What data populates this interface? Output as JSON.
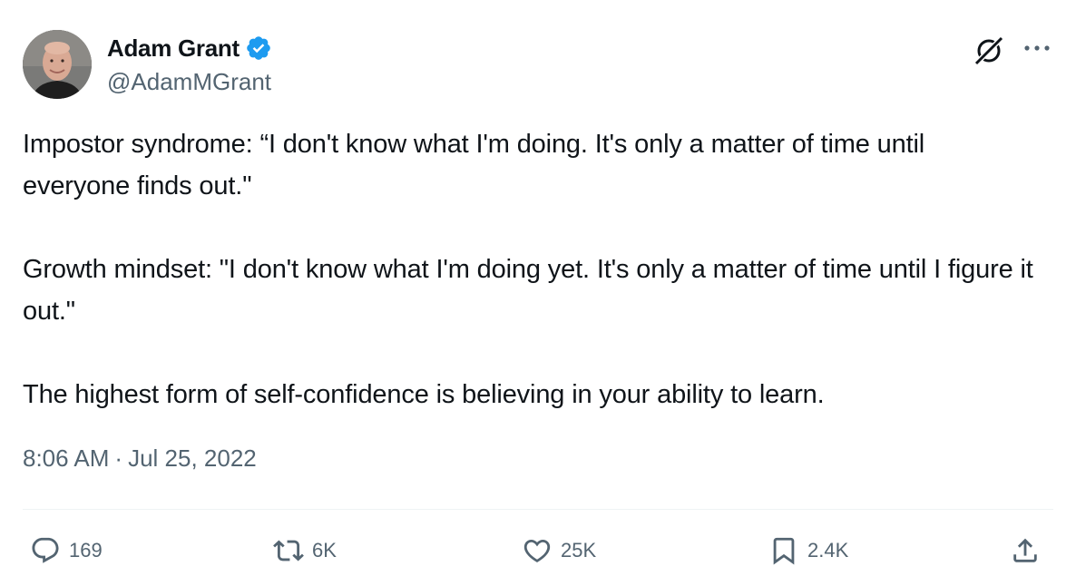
{
  "author": {
    "display_name": "Adam Grant",
    "handle": "@AdamMGrant",
    "verified": true,
    "verified_color": "#1d9bf0"
  },
  "tweet": {
    "paragraphs": [
      "Impostor syndrome: “I don't know what I'm doing. It's only a matter of time until everyone finds out.\"",
      "Growth mindset: \"I don't know what I'm doing yet. It's only a matter of time until I figure it out.\"",
      "The highest form of self-confidence is believing in your ability to learn."
    ],
    "time": "8:06 AM",
    "separator": "·",
    "date": "Jul 25, 2022"
  },
  "actions": {
    "replies": "169",
    "reposts": "6K",
    "likes": "25K",
    "bookmarks": "2.4K"
  },
  "icons": {
    "reply": "speech-bubble-icon",
    "repost": "repost-arrows-icon",
    "like": "heart-icon",
    "bookmark": "bookmark-icon",
    "share": "share-upload-icon",
    "grok": "grok-slash-icon",
    "more": "more-dots-icon"
  },
  "colors": {
    "text_primary": "#0f1419",
    "text_secondary": "#536471",
    "divider": "#eff3f4"
  }
}
